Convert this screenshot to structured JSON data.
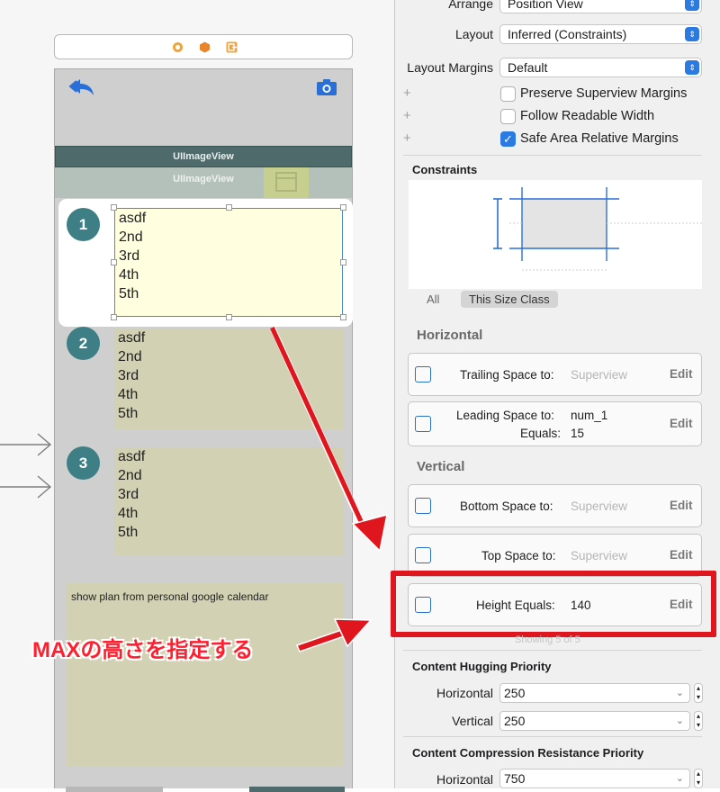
{
  "canvas": {
    "scene_view": {
      "imageview_label_1": "UIImageView",
      "imageview_label_2": "UIImageView",
      "rows": [
        {
          "number": "1",
          "lines": [
            "asdf",
            "2nd",
            "3rd",
            "4th",
            "5th"
          ]
        },
        {
          "number": "2",
          "lines": [
            "asdf",
            "2nd",
            "3rd",
            "4th",
            "5th"
          ]
        },
        {
          "number": "3",
          "lines": [
            "asdf",
            "2nd",
            "3rd",
            "4th",
            "5th"
          ]
        }
      ],
      "calendar_text": "show plan from personal google calendar"
    },
    "colors": {
      "circle": "#3e7f86",
      "row_background": "#d2d1b3",
      "selected_row": "#ffffe0",
      "imageview_bar": "#4e6a6a",
      "annotation_red": "#e0161f"
    }
  },
  "annotation": {
    "text": "MAXの高さを指定する"
  },
  "inspector": {
    "arrange": {
      "label": "Arrange",
      "value": "Position View"
    },
    "layout": {
      "label": "Layout",
      "value": "Inferred (Constraints)"
    },
    "layout_margins": {
      "label": "Layout Margins",
      "value": "Default"
    },
    "checkboxes": [
      {
        "label": "Preserve Superview Margins",
        "checked": false
      },
      {
        "label": "Follow Readable Width",
        "checked": false
      },
      {
        "label": "Safe Area Relative Margins",
        "checked": true
      }
    ],
    "constraints_title": "Constraints",
    "size_class": {
      "all": "All",
      "this": "This Size Class"
    },
    "horizontal_header": "Horizontal",
    "vertical_header": "Vertical",
    "constraints": [
      {
        "label": "Trailing Space to:",
        "target": "Superview",
        "edit": "Edit"
      },
      {
        "label": "Leading Space to:",
        "target": "num_1",
        "equals_label": "Equals:",
        "equals_value": "15",
        "edit": "Edit"
      },
      {
        "label": "Bottom Space to:",
        "target": "Superview",
        "edit": "Edit"
      },
      {
        "label": "Top Space to:",
        "target": "Superview",
        "edit": "Edit"
      },
      {
        "label": "Height Equals:",
        "target": "140",
        "edit": "Edit"
      }
    ],
    "showing": "Showing 5 of 5",
    "hugging": {
      "title": "Content Hugging Priority",
      "horizontal_label": "Horizontal",
      "horizontal_value": "250",
      "vertical_label": "Vertical",
      "vertical_value": "250"
    },
    "compression": {
      "title": "Content Compression Resistance Priority",
      "horizontal_label": "Horizontal",
      "horizontal_value": "750"
    }
  }
}
